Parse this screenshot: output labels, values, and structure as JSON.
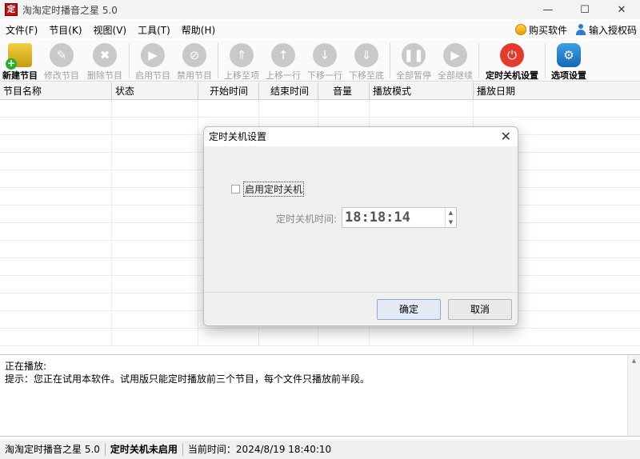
{
  "window": {
    "title": "淘淘定时播音之星 5.0",
    "app_icon_text": "定",
    "min": "—",
    "max": "☐",
    "close": "✕"
  },
  "menu": {
    "items": [
      "文件(F)",
      "节目(K)",
      "视图(V)",
      "工具(T)",
      "帮助(H)"
    ],
    "buy": "购买软件",
    "activate": "输入授权码"
  },
  "toolbar": {
    "new": "新建节目",
    "edit": "修改节目",
    "delete": "删除节目",
    "enable": "启用节目",
    "disable": "禁用节目",
    "move_top": "上移至项",
    "move_up": "上移一行",
    "move_down": "下移一行",
    "move_bottom": "下移至底",
    "pause_all": "全部暂停",
    "resume_all": "全部继续",
    "shutdown_settings": "定时关机设置",
    "options": "选项设置"
  },
  "grid": {
    "columns": [
      "节目名称",
      "状态",
      "开始时间",
      "结束时间",
      "音量",
      "播放模式",
      "播放日期"
    ]
  },
  "dialog": {
    "title": "定时关机设置",
    "close": "✕",
    "enable_label": "启用定时关机",
    "enabled": false,
    "time_label": "定时关机时间:",
    "time_value": "18:18:14",
    "ok": "确定",
    "cancel": "取消"
  },
  "info": {
    "now_playing": "正在播放:",
    "tip": "提示：您正在试用本软件。试用版只能定时播放前三个节目，每个文件只播放前半段。"
  },
  "status": {
    "app": "淘淘定时播音之星 5.0",
    "shutdown": "定时关机未启用",
    "time": "当前时间：2024/8/19 18:40:10"
  },
  "colors": {
    "shutdown_icon": "#e43b2c",
    "options_icon": "#1766b3"
  }
}
